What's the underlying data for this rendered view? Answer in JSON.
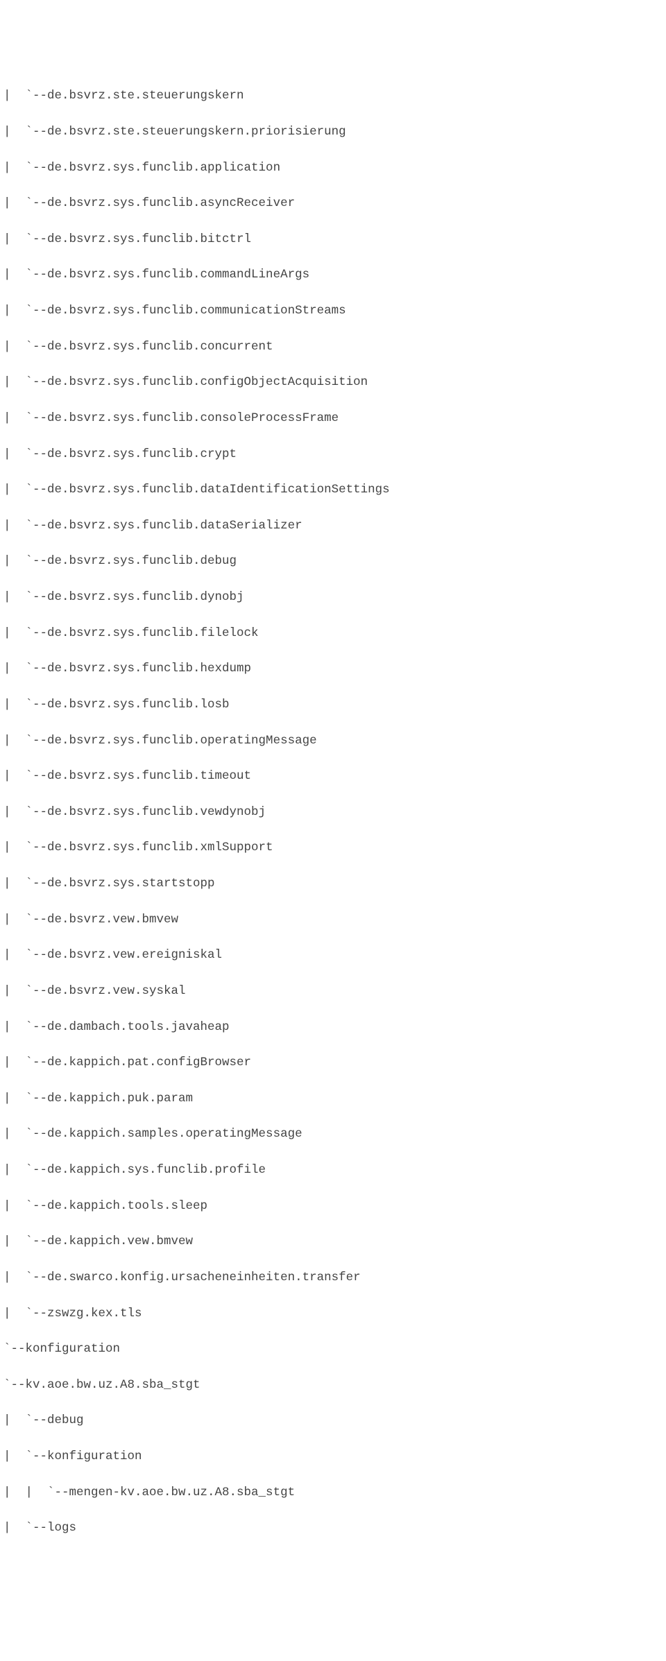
{
  "lines": [
    "|  `--de.bsvrz.ste.steuerungskern",
    "|  `--de.bsvrz.ste.steuerungskern.priorisierung",
    "|  `--de.bsvrz.sys.funclib.application",
    "|  `--de.bsvrz.sys.funclib.asyncReceiver",
    "|  `--de.bsvrz.sys.funclib.bitctrl",
    "|  `--de.bsvrz.sys.funclib.commandLineArgs",
    "|  `--de.bsvrz.sys.funclib.communicationStreams",
    "|  `--de.bsvrz.sys.funclib.concurrent",
    "|  `--de.bsvrz.sys.funclib.configObjectAcquisition",
    "|  `--de.bsvrz.sys.funclib.consoleProcessFrame",
    "|  `--de.bsvrz.sys.funclib.crypt",
    "|  `--de.bsvrz.sys.funclib.dataIdentificationSettings",
    "|  `--de.bsvrz.sys.funclib.dataSerializer",
    "|  `--de.bsvrz.sys.funclib.debug",
    "|  `--de.bsvrz.sys.funclib.dynobj",
    "|  `--de.bsvrz.sys.funclib.filelock",
    "|  `--de.bsvrz.sys.funclib.hexdump",
    "|  `--de.bsvrz.sys.funclib.losb",
    "|  `--de.bsvrz.sys.funclib.operatingMessage",
    "|  `--de.bsvrz.sys.funclib.timeout",
    "|  `--de.bsvrz.sys.funclib.vewdynobj",
    "|  `--de.bsvrz.sys.funclib.xmlSupport",
    "|  `--de.bsvrz.sys.startstopp",
    "|  `--de.bsvrz.vew.bmvew",
    "|  `--de.bsvrz.vew.ereigniskal",
    "|  `--de.bsvrz.vew.syskal",
    "|  `--de.dambach.tools.javaheap",
    "|  `--de.kappich.pat.configBrowser",
    "|  `--de.kappich.puk.param",
    "|  `--de.kappich.samples.operatingMessage",
    "|  `--de.kappich.sys.funclib.profile",
    "|  `--de.kappich.tools.sleep",
    "|  `--de.kappich.vew.bmvew",
    "|  `--de.swarco.konfig.ursacheneinheiten.transfer",
    "|  `--zswzg.kex.tls",
    "`--konfiguration",
    "`--kv.aoe.bw.uz.A8.sba_stgt",
    "|  `--debug",
    "|  `--konfiguration",
    "|  |  `--mengen-kv.aoe.bw.uz.A8.sba_stgt",
    "|  `--logs"
  ]
}
